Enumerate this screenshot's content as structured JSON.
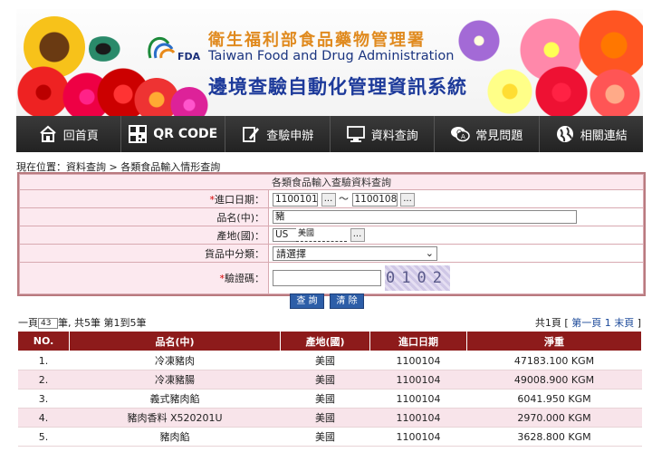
{
  "header": {
    "fda_logo_text": "FDA",
    "agency_zh": "衛生福利部食品藥物管理署",
    "agency_en": "Taiwan Food and Drug Administration",
    "system_title": "邊境查驗自動化管理資訊系統"
  },
  "nav": {
    "items": [
      {
        "label": "回首頁",
        "icon": "home-icon"
      },
      {
        "label": "QR CODE",
        "icon": "qr-code-icon"
      },
      {
        "label": "查驗申辦",
        "icon": "edit-form-icon"
      },
      {
        "label": "資料查詢",
        "icon": "monitor-icon"
      },
      {
        "label": "常見問題",
        "icon": "chat-question-icon"
      },
      {
        "label": "相關連結",
        "icon": "globe-icon"
      }
    ]
  },
  "breadcrumb": "現在位置：資料查詢 > 各類食品輸入情形查詢",
  "form": {
    "caption": "各類食品輸入查驗資料查詢",
    "import_date_label": "進口日期：",
    "import_date_from": "1100101",
    "import_date_to": "1100108",
    "date_separator": "～",
    "product_label": "品名(中)：",
    "product_value": "豬",
    "origin_label": "產地(國)：",
    "origin_code": "US",
    "origin_name": "美國",
    "category_label": "貨品中分類：",
    "category_value": "請選擇",
    "captcha_label": "驗證碼：",
    "captcha_image_text": "0102",
    "browse_label": "...",
    "required_mark": "*",
    "select_arrow": "⌄"
  },
  "buttons": {
    "search": "查 詢",
    "clear": "清 除"
  },
  "pager": {
    "prefix": "一頁",
    "per_page": "43",
    "summary": "筆, 共5筆 第1到5筆",
    "pages_label": "共1頁 [",
    "first_page": "第一頁",
    "current_page": "1",
    "last_page": "末頁",
    "end": "]"
  },
  "results": {
    "headers": [
      "NO.",
      "品名(中)",
      "產地(國)",
      "進口日期",
      "淨重"
    ],
    "rows": [
      [
        "1.",
        "冷凍豬肉",
        "美國",
        "1100104",
        "47183.100 KGM"
      ],
      [
        "2.",
        "冷凍豬腸",
        "美國",
        "1100104",
        "49008.900 KGM"
      ],
      [
        "3.",
        "義式豬肉餡",
        "美國",
        "1100104",
        "6041.950 KGM"
      ],
      [
        "4.",
        "豬肉香料 X520201U",
        "美國",
        "1100104",
        "2970.000 KGM"
      ],
      [
        "5.",
        "豬肉餡",
        "美國",
        "1100104",
        "3628.800 KGM"
      ]
    ]
  },
  "colors": {
    "nav_bg": "#2c2c2c",
    "table_header": "#8d1b1b",
    "form_bg": "#fce9ef",
    "button": "#2d5ea8",
    "required": "#d40000"
  }
}
